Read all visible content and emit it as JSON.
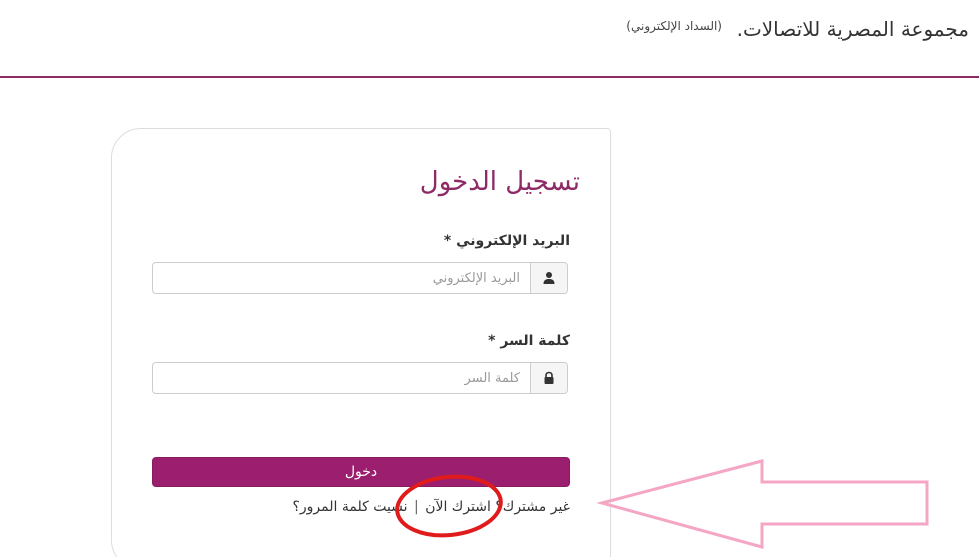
{
  "header": {
    "brand": "مجموعة المصرية للاتصالات.",
    "subtitle": "(السداد الإلكتروني)"
  },
  "login": {
    "title": "تسجيل الدخول",
    "email_label": "البريد الإلكتروني",
    "email_placeholder": "البريد الإلكتروني",
    "email_value": "",
    "password_label": "كلمة السر",
    "password_placeholder": "كلمة السر",
    "password_value": "",
    "required_mark": "*",
    "submit_label": "دخول",
    "not_member_text": "غير مشترك؟",
    "signup_link": "اشترك الآن",
    "separator": "|",
    "forgot_link": "نسيت كلمة المرور؟"
  },
  "icons": {
    "email": "user-icon",
    "password": "lock-icon"
  },
  "colors": {
    "accent": "#9b1f6e",
    "title": "#8e2a66",
    "annotation_arrow": "#f4a6c4",
    "annotation_circle": "#e01b1b"
  }
}
